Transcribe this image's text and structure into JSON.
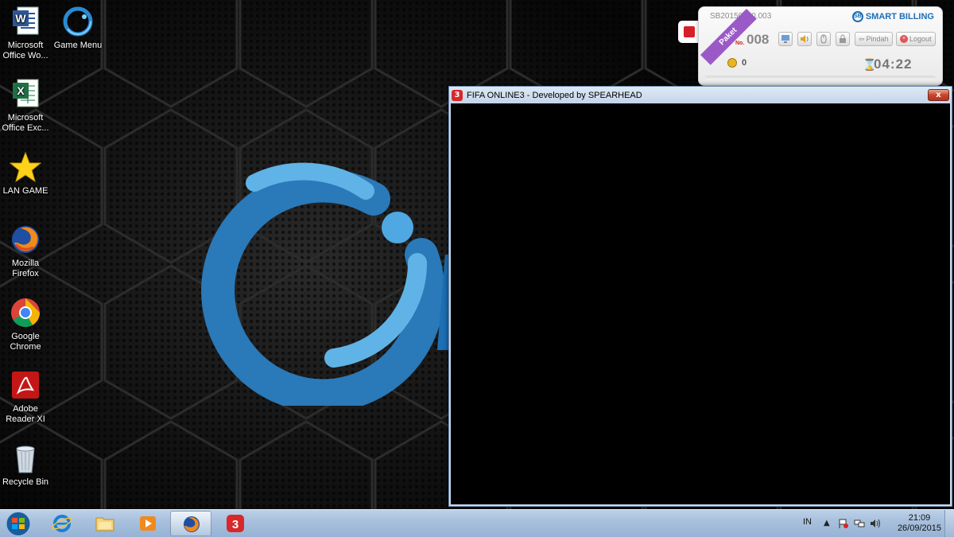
{
  "desktop": {
    "icons": [
      {
        "name": "Microsoft Office Word",
        "label": "Microsoft Office Wo..."
      },
      {
        "name": "Game Menu",
        "label": "Game Menu"
      },
      {
        "name": "Microsoft Office Excel",
        "label": "Microsoft Office Exc..."
      },
      {
        "name": "LAN GAME",
        "label": "LAN GAME"
      },
      {
        "name": "Mozilla Firefox",
        "label": "Mozilla Firefox"
      },
      {
        "name": "Google Chrome",
        "label": "Google Chrome"
      },
      {
        "name": "Adobe Reader XI",
        "label": "Adobe Reader XI"
      },
      {
        "name": "Recycle Bin",
        "label": "Recycle Bin"
      }
    ]
  },
  "fifa_window": {
    "title": "FIFA ONLINE3 - Developed by SPEARHEAD",
    "icon": "fifa-3-icon",
    "close_label": "x"
  },
  "billing": {
    "serial": "SB20150910.003",
    "brand": "SMART BILLING",
    "ribbon": "Paket",
    "no_label": "No.",
    "number": "008",
    "pindah_label": "Pindah",
    "logout_label": "Logout",
    "credit": "0",
    "timer": "04:22",
    "accent_color": "#1d6fb6",
    "ribbon_color": "#9b59c8"
  },
  "taskbar": {
    "pinned": [
      "internet-explorer-icon",
      "explorer-folder-icon",
      "media-player-icon",
      "firefox-icon",
      "fifa-online-3-icon"
    ],
    "active": "firefox-icon",
    "tray": {
      "language": "IN",
      "time": "21:09",
      "date": "26/09/2015"
    }
  }
}
